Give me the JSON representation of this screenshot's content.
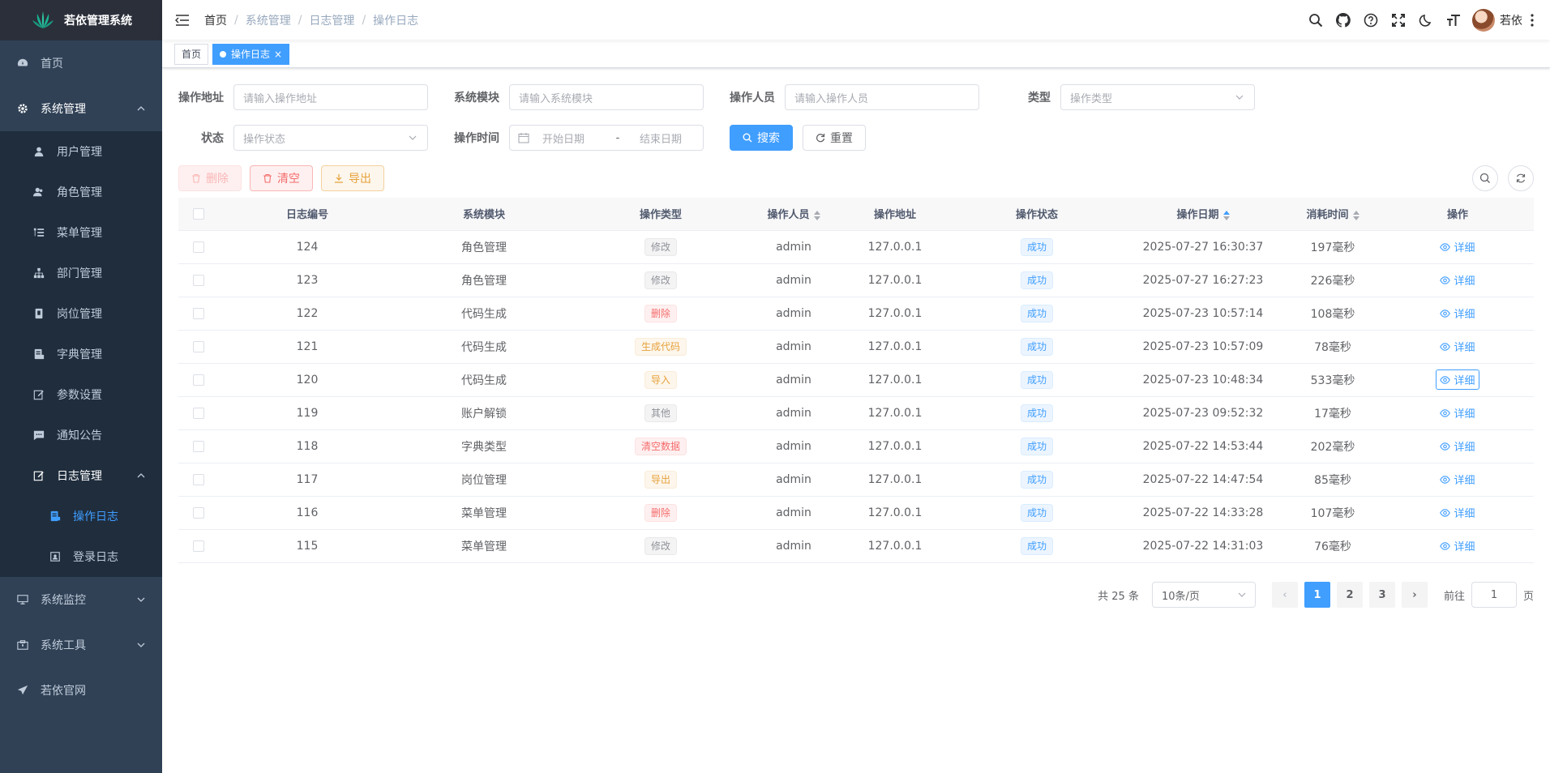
{
  "app": {
    "title": "若依管理系统"
  },
  "sidebar": {
    "home": "首页",
    "system": "系统管理",
    "system_items": [
      "用户管理",
      "角色管理",
      "菜单管理",
      "部门管理",
      "岗位管理",
      "字典管理",
      "参数设置",
      "通知公告"
    ],
    "log": "日志管理",
    "log_items": [
      "操作日志",
      "登录日志"
    ],
    "monitor": "系统监控",
    "tools": "系统工具",
    "website": "若依官网"
  },
  "navbar": {
    "breadcrumb": [
      "首页",
      "系统管理",
      "日志管理",
      "操作日志"
    ],
    "username": "若依"
  },
  "tags": {
    "home": "首页",
    "current": "操作日志",
    "close": "×"
  },
  "search": {
    "address_label": "操作地址",
    "address_placeholder": "请输入操作地址",
    "module_label": "系统模块",
    "module_placeholder": "请输入系统模块",
    "operator_label": "操作人员",
    "operator_placeholder": "请输入操作人员",
    "type_label": "类型",
    "type_placeholder": "操作类型",
    "status_label": "状态",
    "status_placeholder": "操作状态",
    "time_label": "操作时间",
    "start_placeholder": "开始日期",
    "range_sep": "-",
    "end_placeholder": "结束日期",
    "search_btn": "搜索",
    "reset_btn": "重置"
  },
  "toolbar": {
    "delete": "删除",
    "clear": "清空",
    "export": "导出"
  },
  "table": {
    "headers": [
      "日志编号",
      "系统模块",
      "操作类型",
      "操作人员",
      "操作地址",
      "操作状态",
      "操作日期",
      "消耗时间",
      "操作"
    ],
    "detail": "详细",
    "rows": [
      {
        "id": "124",
        "module": "角色管理",
        "type": "修改",
        "type_style": "info",
        "operator": "admin",
        "ip": "127.0.0.1",
        "status": "成功",
        "date": "2025-07-27 16:30:37",
        "cost": "197毫秒"
      },
      {
        "id": "123",
        "module": "角色管理",
        "type": "修改",
        "type_style": "info",
        "operator": "admin",
        "ip": "127.0.0.1",
        "status": "成功",
        "date": "2025-07-27 16:27:23",
        "cost": "226毫秒"
      },
      {
        "id": "122",
        "module": "代码生成",
        "type": "删除",
        "type_style": "danger",
        "operator": "admin",
        "ip": "127.0.0.1",
        "status": "成功",
        "date": "2025-07-23 10:57:14",
        "cost": "108毫秒"
      },
      {
        "id": "121",
        "module": "代码生成",
        "type": "生成代码",
        "type_style": "warning",
        "operator": "admin",
        "ip": "127.0.0.1",
        "status": "成功",
        "date": "2025-07-23 10:57:09",
        "cost": "78毫秒"
      },
      {
        "id": "120",
        "module": "代码生成",
        "type": "导入",
        "type_style": "warning",
        "operator": "admin",
        "ip": "127.0.0.1",
        "status": "成功",
        "date": "2025-07-23 10:48:34",
        "cost": "533毫秒"
      },
      {
        "id": "119",
        "module": "账户解锁",
        "type": "其他",
        "type_style": "info",
        "operator": "admin",
        "ip": "127.0.0.1",
        "status": "成功",
        "date": "2025-07-23 09:52:32",
        "cost": "17毫秒"
      },
      {
        "id": "118",
        "module": "字典类型",
        "type": "清空数据",
        "type_style": "danger",
        "operator": "admin",
        "ip": "127.0.0.1",
        "status": "成功",
        "date": "2025-07-22 14:53:44",
        "cost": "202毫秒"
      },
      {
        "id": "117",
        "module": "岗位管理",
        "type": "导出",
        "type_style": "warning",
        "operator": "admin",
        "ip": "127.0.0.1",
        "status": "成功",
        "date": "2025-07-22 14:47:54",
        "cost": "85毫秒"
      },
      {
        "id": "116",
        "module": "菜单管理",
        "type": "删除",
        "type_style": "danger",
        "operator": "admin",
        "ip": "127.0.0.1",
        "status": "成功",
        "date": "2025-07-22 14:33:28",
        "cost": "107毫秒"
      },
      {
        "id": "115",
        "module": "菜单管理",
        "type": "修改",
        "type_style": "info",
        "operator": "admin",
        "ip": "127.0.0.1",
        "status": "成功",
        "date": "2025-07-22 14:31:03",
        "cost": "76毫秒"
      }
    ]
  },
  "pagination": {
    "total": "共 25 条",
    "page_size": "10条/页",
    "pages": [
      "1",
      "2",
      "3"
    ],
    "prev": "‹",
    "next": "›",
    "jump_prefix": "前往",
    "jump_value": "1",
    "jump_suffix": "页"
  },
  "colors": {
    "primary": "#409eff",
    "sidebar_bg": "#304156",
    "submenu_bg": "#1f2d3d"
  }
}
